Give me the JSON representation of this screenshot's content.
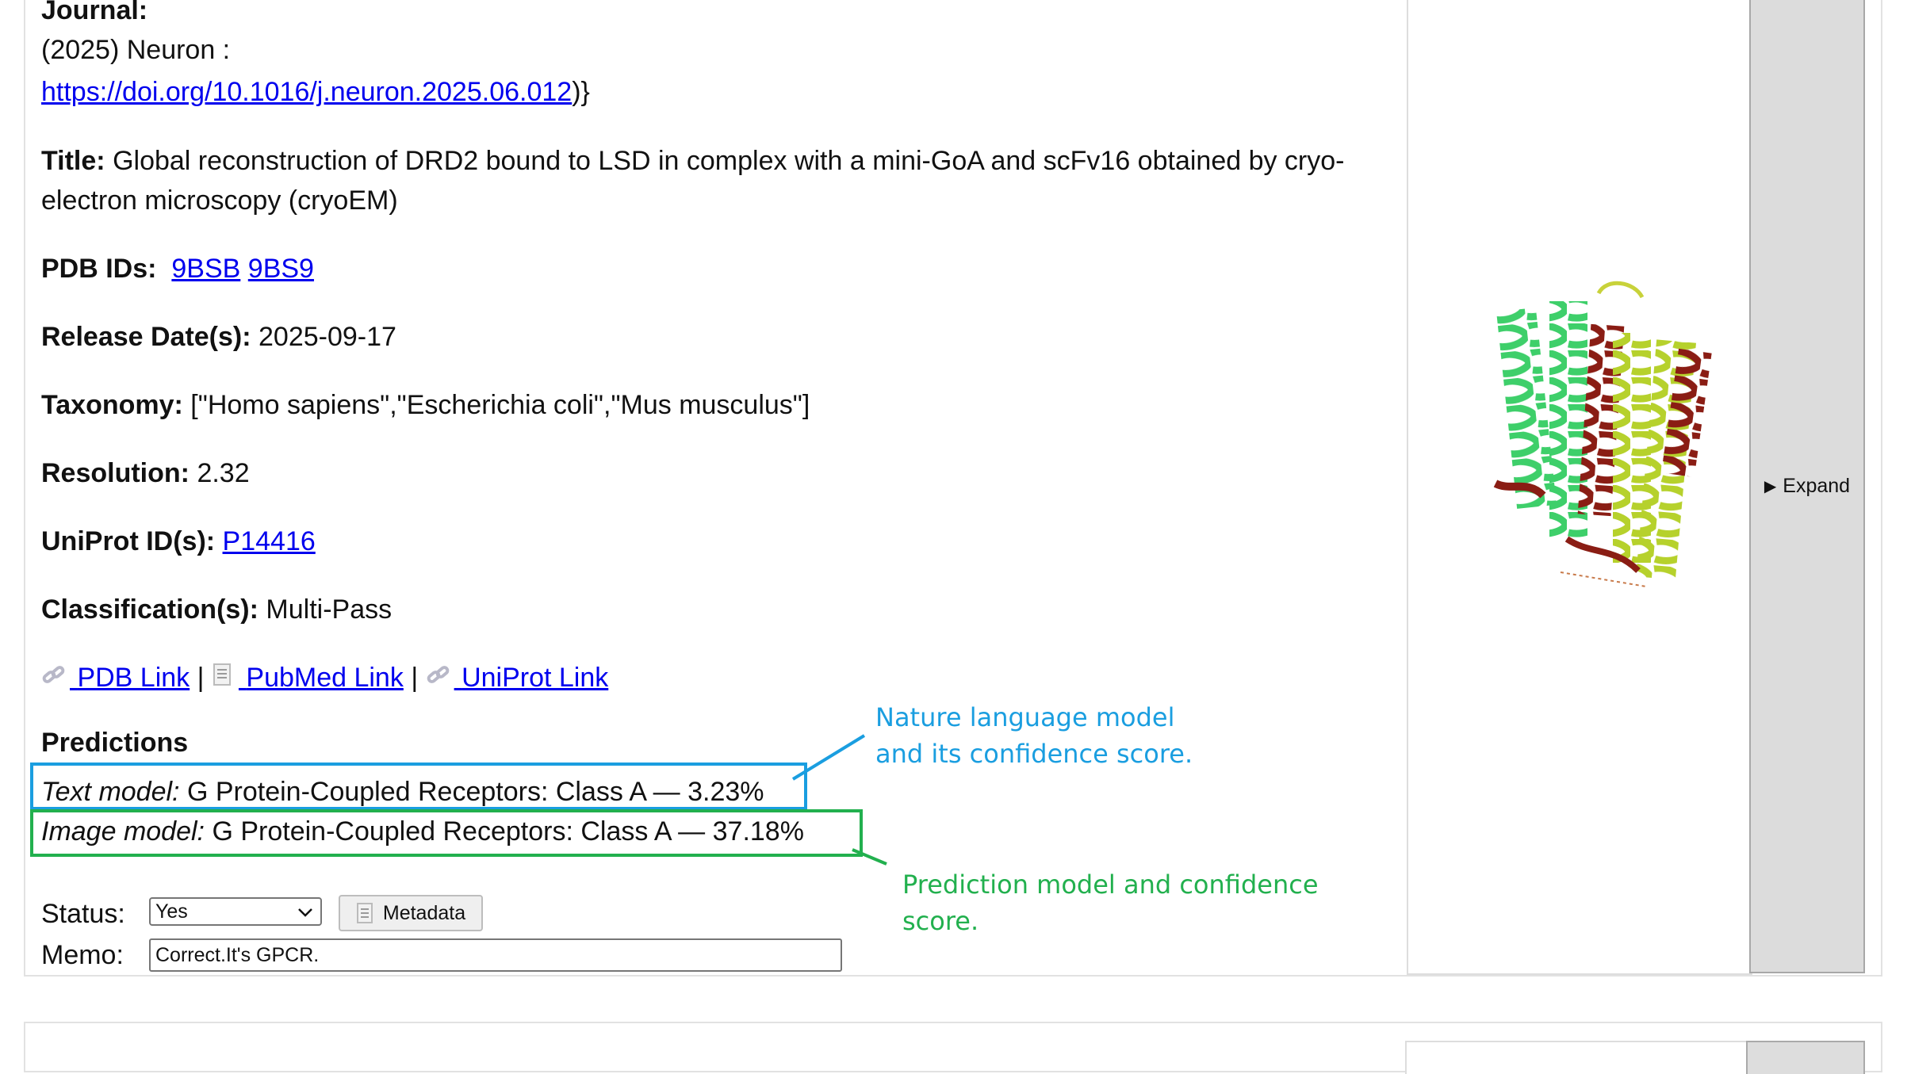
{
  "entry": {
    "journal_label": "Journal:",
    "journal_text": "(2025) Neuron :",
    "doi_link": "https://doi.org/10.1016/j.neuron.2025.06.012",
    "doi_suffix": ")}",
    "title_label": "Title:",
    "title_line1": "Global reconstruction of DRD2 bound to LSD in complex with a mini-GoA and scFv16 obtained by cryo-",
    "title_line2": "electron microscopy (cryoEM)",
    "pdb_label": "PDB IDs:",
    "pdb_ids": [
      "9BSB",
      "9BS9"
    ],
    "release_label": "Release Date(s):",
    "release_value": "2025-09-17",
    "taxonomy_label": "Taxonomy:",
    "taxonomy_value": "[\"Homo sapiens\",\"Escherichia coli\",\"Mus musculus\"]",
    "resolution_label": "Resolution:",
    "resolution_value": "2.32",
    "uniprot_label": "UniProt ID(s):",
    "uniprot_value": "P14416",
    "classification_label": "Classification(s):",
    "classification_value": "Multi-Pass",
    "links": {
      "pdb": "PDB Link",
      "pubmed": "PubMed Link",
      "uniprot": "UniProt Link",
      "separator": "|"
    }
  },
  "predictions": {
    "heading": "Predictions",
    "text_model_label": "Text model:",
    "text_model_value": "G Protein-Coupled Receptors: Class A — 3.23%",
    "image_model_label": "Image model:",
    "image_model_value": "G Protein-Coupled Receptors: Class A — 37.18%"
  },
  "form": {
    "status_label": "Status:",
    "status_value": "Yes",
    "metadata_button": "Metadata",
    "memo_label": "Memo:",
    "memo_value": "Correct.It's GPCR."
  },
  "expand_label": "Expand",
  "annotations": {
    "text_note_line1": "Nature language model",
    "text_note_line2": "and its confidence score.",
    "image_note_line1": "Prediction model and confidence",
    "image_note_line2": "score."
  },
  "colors": {
    "text_note": "#1a9ee0",
    "image_note": "#22b04e",
    "link": "#0000ee"
  }
}
